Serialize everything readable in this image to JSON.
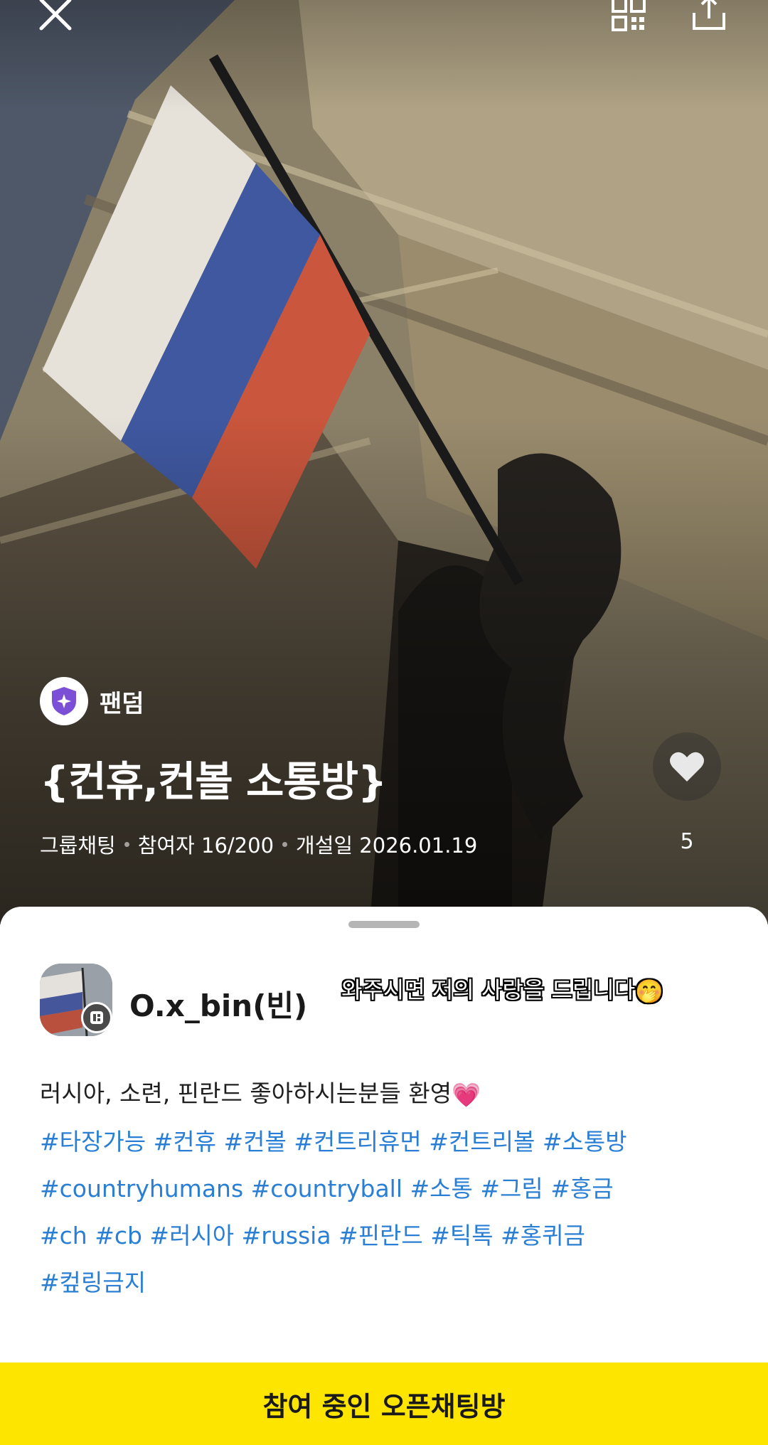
{
  "header": {
    "close_icon": "close-icon",
    "qr_icon": "qr-code-icon",
    "share_icon": "share-icon"
  },
  "room": {
    "badge_icon": "fandom-shield-icon",
    "badge_label": "팬덤",
    "title": "{컨휴,컨볼 소통방}",
    "type": "그룹채팅",
    "participants": "참여자 16/200",
    "opened": "개설일 2026.01.19",
    "like_icon": "heart-icon",
    "like_count": "5"
  },
  "owner": {
    "name": "O.x_bin(빈)",
    "caption": "와주시면 저의 사랑을 드립니다",
    "caption_emoji": "🤭"
  },
  "description": {
    "text": "러시아, 소련, 핀란드 좋아하시는분들 환영",
    "emoji": "💗",
    "hashtag_lines": [
      "#타장가능 #컨휴 #컨볼 #컨트리휴먼 #컨트리볼 #소통방",
      "#countryhumans #countryball #소통 #그림 #홍금",
      "#ch #cb #러시아 #russia #핀란드 #틱톡 #홍퀴금",
      "#컾링금지"
    ]
  },
  "join_button": {
    "label": "참여 중인 오픈채팅방"
  },
  "colors": {
    "join_button": "#fee500",
    "hashtag": "#2a7fd4",
    "badge_accent": "#7b4fd6"
  }
}
